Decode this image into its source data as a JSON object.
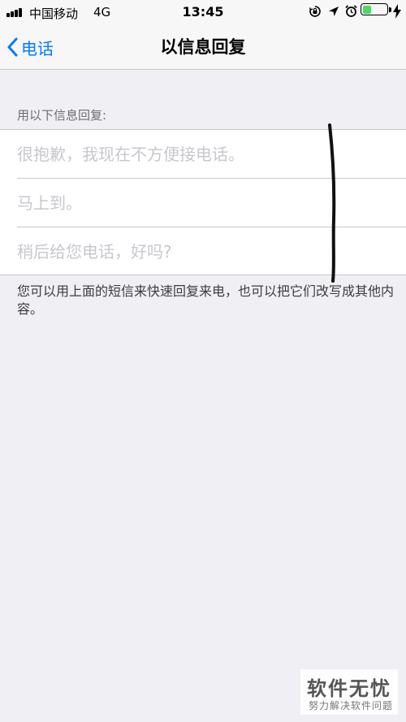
{
  "status_bar": {
    "carrier": "中国移动",
    "network": "4G",
    "time": "13:45",
    "icons": [
      "signal-icon",
      "orientation-lock-icon",
      "location-arrow-icon",
      "alarm-icon",
      "battery-icon",
      "charging-bolt-icon"
    ],
    "battery_level": 0.35,
    "battery_color": "#4cd964"
  },
  "nav": {
    "back_label": "电话",
    "title": "以信息回复",
    "accent_color": "#007aff"
  },
  "section": {
    "header": "用以下信息回复:",
    "replies": [
      {
        "value": "",
        "placeholder": "很抱歉，我现在不方便接电话。"
      },
      {
        "value": "",
        "placeholder": "马上到。"
      },
      {
        "value": "",
        "placeholder": "稍后给您电话，好吗?"
      }
    ],
    "footer": "您可以用上面的短信来快速回复来电，也可以把它们改写成其他内容。"
  },
  "watermark": {
    "title": "软件无忧",
    "subtitle": "努力解决软件问题"
  }
}
